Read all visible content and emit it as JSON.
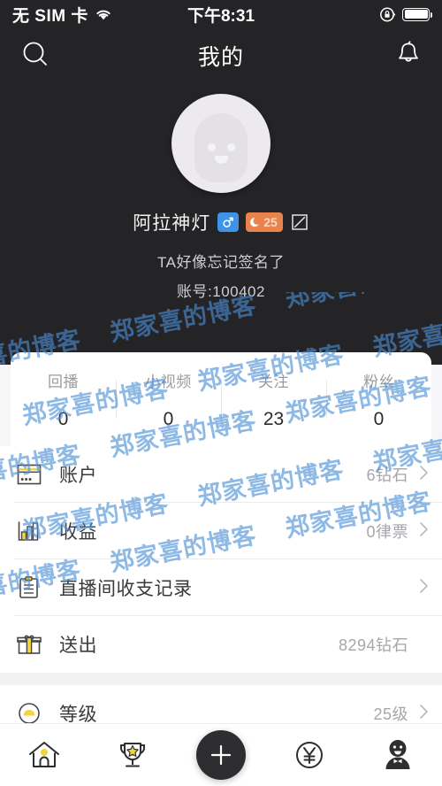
{
  "status_bar": {
    "carrier": "无 SIM 卡",
    "wifi_icon": "wifi-icon",
    "time": "下午8:31",
    "rotation_lock_icon": "rotation-lock-icon",
    "battery_icon": "battery-icon"
  },
  "header": {
    "search_icon": "search-icon",
    "title": "我的",
    "bell_icon": "bell-icon"
  },
  "profile": {
    "avatar_icon": "default-avatar-icon",
    "username": "阿拉神灯",
    "gender_badge": "male-icon",
    "level_badge": {
      "moon_icon": "moon-icon",
      "level": "25"
    },
    "edit_icon": "edit-icon",
    "signature": "TA好像忘记签名了",
    "account": "账号:100402"
  },
  "stats": [
    {
      "label": "回播",
      "value": "0"
    },
    {
      "label": "小视频",
      "value": "0"
    },
    {
      "label": "关注",
      "value": "23"
    },
    {
      "label": "粉丝",
      "value": "0"
    }
  ],
  "menu": [
    {
      "icon": "card-icon",
      "label": "账户",
      "value": "6钻石",
      "chevron": true
    },
    {
      "icon": "bar-chart-icon",
      "label": "收益",
      "value": "0律票",
      "chevron": true
    },
    {
      "icon": "clipboard-icon",
      "label": "直播间收支记录",
      "value": "",
      "chevron": true
    },
    {
      "icon": "gift-icon",
      "label": "送出",
      "value": "8294钻石",
      "chevron": false
    },
    {
      "icon": "level-icon",
      "label": "等级",
      "value": "25级",
      "chevron": true
    }
  ],
  "tabbar": [
    {
      "icon": "home-icon",
      "name": "tab-home"
    },
    {
      "icon": "trophy-icon",
      "name": "tab-rank"
    },
    {
      "icon": "plus-icon",
      "name": "tab-publish"
    },
    {
      "icon": "yen-icon",
      "name": "tab-wallet"
    },
    {
      "icon": "person-icon",
      "name": "tab-profile"
    }
  ],
  "watermark": {
    "text": "郑家喜的博客"
  },
  "colors": {
    "dark_bg": "#242427",
    "accent_yellow": "#f2d43c",
    "badge_blue": "#3e93e8",
    "badge_orange": "#e8834d",
    "watermark_blue": "#4a8fd6"
  }
}
